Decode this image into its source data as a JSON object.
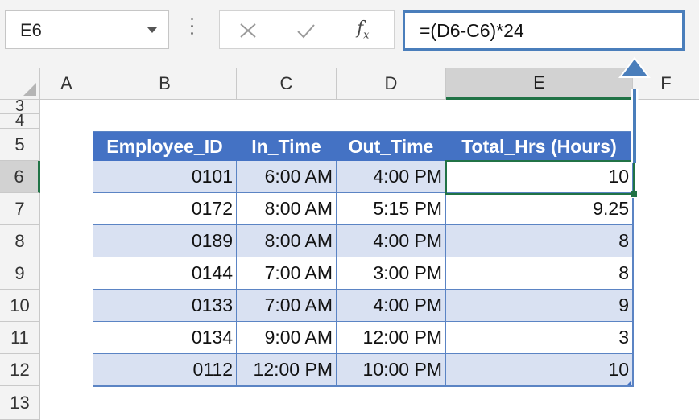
{
  "name_box": {
    "value": "E6"
  },
  "formula_bar": {
    "value": "=(D6-C6)*24",
    "fx_label": "f",
    "fx_sub": "x"
  },
  "columns": [
    "A",
    "B",
    "C",
    "D",
    "E",
    "F"
  ],
  "rows": [
    "3",
    "4",
    "5",
    "6",
    "7",
    "8",
    "9",
    "10",
    "11",
    "12",
    "13"
  ],
  "selected_cell": "E6",
  "table": {
    "headers": [
      "Employee_ID",
      "In_Time",
      "Out_Time",
      "Total_Hrs (Hours)"
    ],
    "rows": [
      [
        "0101",
        "6:00 AM",
        "4:00 PM",
        "10"
      ],
      [
        "0172",
        "8:00 AM",
        "5:15 PM",
        "9.25"
      ],
      [
        "0189",
        "8:00 AM",
        "4:00 PM",
        "8"
      ],
      [
        "0144",
        "7:00 AM",
        "3:00 PM",
        "8"
      ],
      [
        "0133",
        "7:00 AM",
        "4:00 PM",
        "9"
      ],
      [
        "0134",
        "9:00 AM",
        "12:00 PM",
        "3"
      ],
      [
        "0112",
        "12:00 PM",
        "10:00 PM",
        "10"
      ]
    ]
  },
  "colors": {
    "table_header": "#4472c4",
    "band": "#d9e1f2",
    "selection": "#217346",
    "callout_arrow": "#4a7ebb"
  }
}
